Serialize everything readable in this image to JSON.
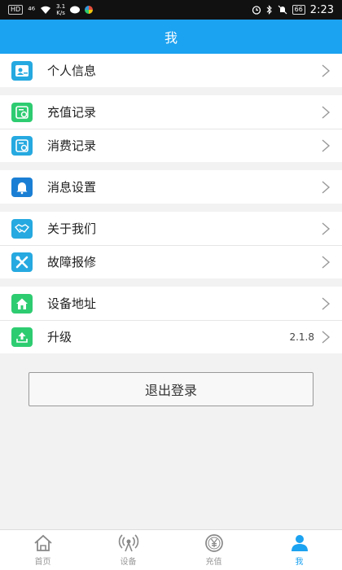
{
  "status_bar": {
    "network_badge": "HD",
    "signal": "⁴⁶",
    "speed_top": "3.1",
    "speed_bottom": "K/s",
    "battery": "66",
    "time": "2:23"
  },
  "header": {
    "title": "我"
  },
  "groups": [
    {
      "items": [
        {
          "label": "个人信息",
          "icon": "user-card-icon",
          "color": "#26a9e0"
        }
      ]
    },
    {
      "items": [
        {
          "label": "充值记录",
          "icon": "recharge-record-icon",
          "color": "#2ecc71"
        },
        {
          "label": "消费记录",
          "icon": "consume-record-icon",
          "color": "#26a9e0"
        }
      ]
    },
    {
      "items": [
        {
          "label": "消息设置",
          "icon": "bell-icon",
          "color": "#1a7fd4"
        }
      ]
    },
    {
      "items": [
        {
          "label": "关于我们",
          "icon": "handshake-icon",
          "color": "#26a9e0"
        },
        {
          "label": "故障报修",
          "icon": "tools-icon",
          "color": "#26a9e0"
        }
      ]
    },
    {
      "items": [
        {
          "label": "设备地址",
          "icon": "home-icon",
          "color": "#2ecc71"
        },
        {
          "label": "升级",
          "icon": "upload-icon",
          "color": "#2ecc71",
          "version": "2.1.8"
        }
      ]
    }
  ],
  "logout_label": "退出登录",
  "tabs": [
    {
      "label": "首页",
      "icon": "home-outline-icon",
      "active": false
    },
    {
      "label": "设备",
      "icon": "signal-tower-icon",
      "active": false
    },
    {
      "label": "充值",
      "icon": "yen-coin-icon",
      "active": false
    },
    {
      "label": "我",
      "icon": "person-icon",
      "active": true
    }
  ],
  "colors": {
    "accent": "#1ba2f0"
  }
}
